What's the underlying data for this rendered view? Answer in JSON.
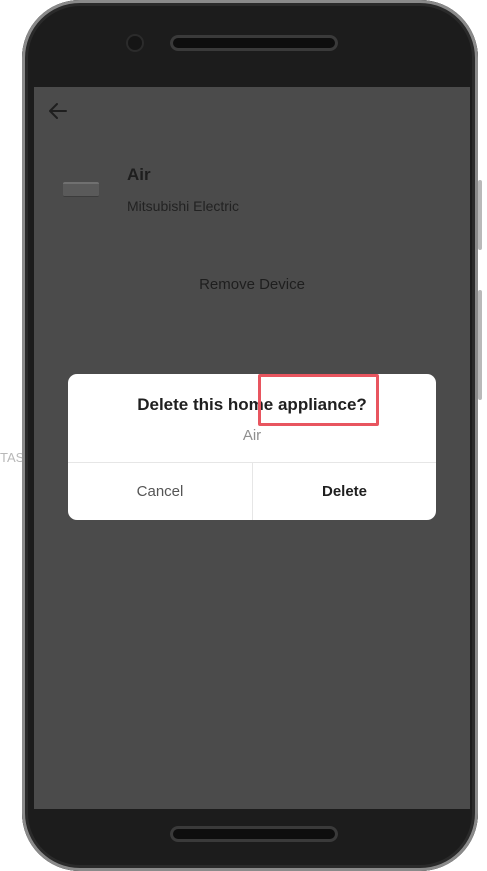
{
  "background_label": "TAS",
  "screen": {
    "device": {
      "name": "Air",
      "brand": "Mitsubishi Electric"
    },
    "remove_device_label": "Remove Device"
  },
  "dialog": {
    "title": "Delete this home appliance?",
    "subtitle": "Air",
    "cancel_label": "Cancel",
    "delete_label": "Delete"
  },
  "colors": {
    "overlay_screen": "#4b4b4b",
    "dialog_bg": "#ffffff",
    "highlight": "#e8555f"
  },
  "icons": {
    "back": "arrow-left-icon",
    "device": "air-conditioner-icon"
  }
}
